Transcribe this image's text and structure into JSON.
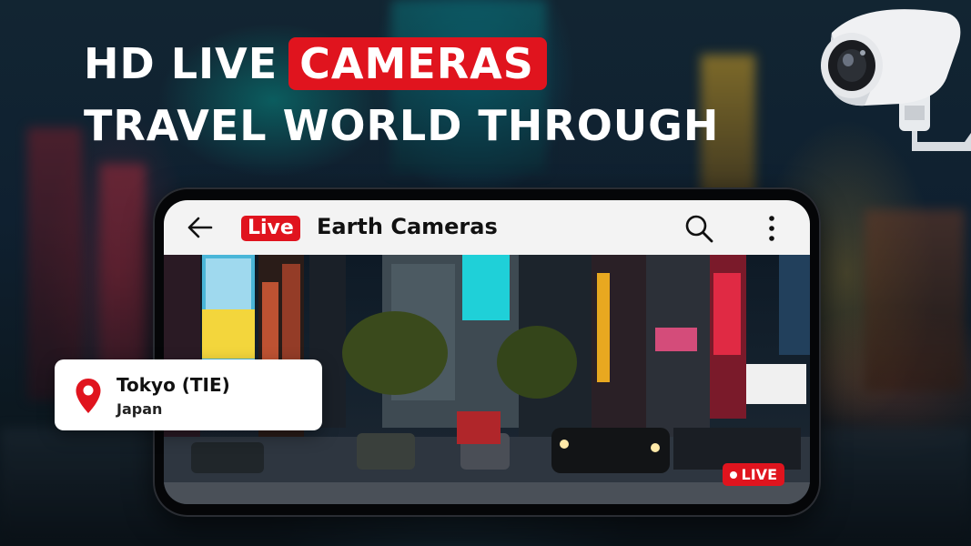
{
  "headline": {
    "line1_prefix": "HD LIVE",
    "line1_highlight": "CAMERAS",
    "line2": "TRAVEL WORLD THROUGH"
  },
  "app": {
    "logo_label": "Live",
    "title": "Earth Cameras",
    "back_icon": "arrow-left-icon",
    "search_icon": "search-icon",
    "menu_icon": "more-vertical-icon"
  },
  "stream": {
    "live_badge": "LIVE"
  },
  "location": {
    "name": "Tokyo (TIE)",
    "country": "Japan",
    "icon": "map-pin-icon"
  },
  "colors": {
    "accent_red": "#e0141e",
    "appbar_bg": "#f3f3f3",
    "card_bg": "#ffffff"
  }
}
